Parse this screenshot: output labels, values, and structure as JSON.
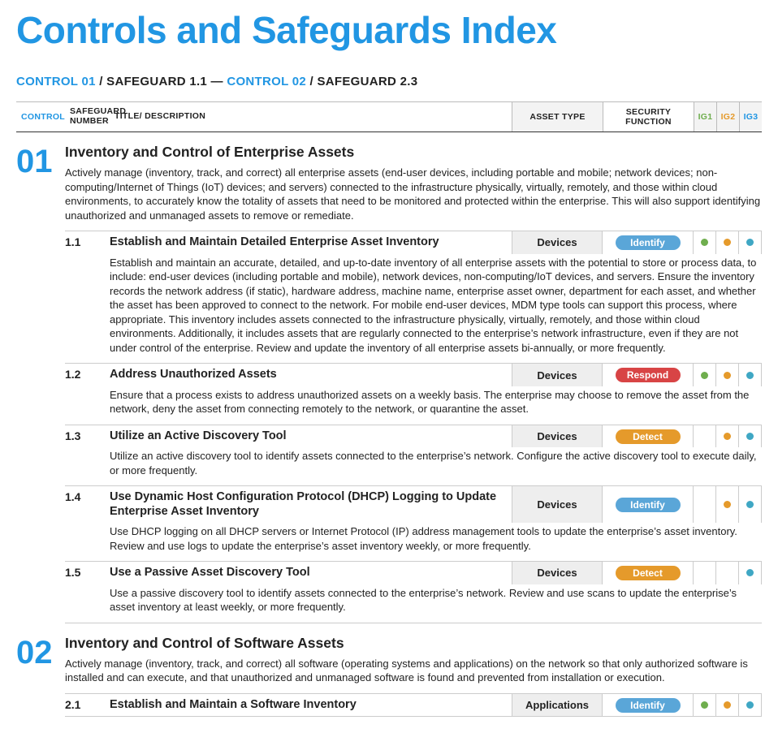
{
  "page_title": "Controls and Safeguards Index",
  "breadcrumb": {
    "c1": "CONTROL 01",
    "sg1": " / SAFEGUARD 1.1 — ",
    "c2": "CONTROL 02",
    "sg2": " / SAFEGUARD 2.3"
  },
  "header": {
    "control": "CONTROL",
    "sg_num": "SAFEGUARD NUMBER",
    "title": "TITLE/ DESCRIPTION",
    "asset": "ASSET TYPE",
    "sec": "SECURITY FUNCTION",
    "ig1": "IG1",
    "ig2": "IG2",
    "ig3": "IG3"
  },
  "controls": [
    {
      "num": "01",
      "title": "Inventory and Control of Enterprise Assets",
      "desc": "Actively manage (inventory, track, and correct) all enterprise assets (end-user devices, including portable and mobile; network devices; non-computing/Internet of Things (IoT) devices; and servers) connected to the infrastructure physically, virtually, remotely, and those within cloud environments, to accurately know the totality of assets that need to be monitored and protected within the enterprise. This will also support identifying unauthorized and unmanaged assets to remove or remediate.",
      "safeguards": [
        {
          "num": "1.1",
          "title": "Establish and Maintain Detailed Enterprise Asset Inventory",
          "asset": "Devices",
          "sec": "Identify",
          "sec_class": "identify",
          "ig": [
            true,
            true,
            true
          ],
          "desc": "Establish and maintain an accurate, detailed, and up-to-date inventory of all enterprise assets with the potential to store or process data, to include: end-user devices (including portable and mobile), network devices, non-computing/IoT devices, and servers. Ensure the inventory records the network address (if static), hardware address, machine name, enterprise asset owner, department for each asset, and whether the asset has been approved to connect to the network. For mobile end-user devices, MDM type tools can support this process, where appropriate. This inventory includes assets connected to the infrastructure physically, virtually, remotely, and those within cloud environments. Additionally, it includes assets that are regularly connected to the enterprise’s network infrastructure, even if they are not under control of the enterprise. Review and update the inventory of all enterprise assets bi-annually, or more frequently."
        },
        {
          "num": "1.2",
          "title": "Address Unauthorized Assets",
          "asset": "Devices",
          "sec": "Respond",
          "sec_class": "respond",
          "ig": [
            true,
            true,
            true
          ],
          "desc": "Ensure that a process exists to address unauthorized assets on a weekly basis. The enterprise may choose to remove the asset from the network, deny the asset from connecting remotely to the network, or quarantine the asset."
        },
        {
          "num": "1.3",
          "title": "Utilize an Active Discovery Tool",
          "asset": "Devices",
          "sec": "Detect",
          "sec_class": "detect",
          "ig": [
            false,
            true,
            true
          ],
          "desc": "Utilize an active discovery tool to identify assets connected to the enterprise’s network. Configure the active discovery tool to execute daily, or more frequently."
        },
        {
          "num": "1.4",
          "title": "Use Dynamic Host Configuration Protocol (DHCP) Logging to Update Enterprise Asset Inventory",
          "asset": "Devices",
          "sec": "Identify",
          "sec_class": "identify",
          "ig": [
            false,
            true,
            true
          ],
          "desc": "Use DHCP logging on all DHCP servers or Internet Protocol (IP) address management tools to update the enterprise’s asset inventory. Review and use logs to update the enterprise’s asset inventory weekly, or more frequently."
        },
        {
          "num": "1.5",
          "title": "Use a Passive Asset Discovery Tool",
          "asset": "Devices",
          "sec": "Detect",
          "sec_class": "detect",
          "ig": [
            false,
            false,
            true
          ],
          "desc": "Use a passive discovery tool to identify assets connected to the enterprise’s network. Review and use scans to update the enterprise’s asset inventory at least weekly, or more frequently."
        }
      ]
    },
    {
      "num": "02",
      "title": "Inventory and Control of Software Assets",
      "desc": "Actively manage (inventory, track, and correct) all software (operating systems and applications) on the network so that only authorized software is installed and can execute, and that unauthorized and unmanaged software is found and prevented from installation or execution.",
      "safeguards": [
        {
          "num": "2.1",
          "title": "Establish and Maintain a Software Inventory",
          "asset": "Applications",
          "sec": "Identify",
          "sec_class": "identify",
          "ig": [
            true,
            true,
            true
          ],
          "desc": ""
        }
      ]
    }
  ]
}
